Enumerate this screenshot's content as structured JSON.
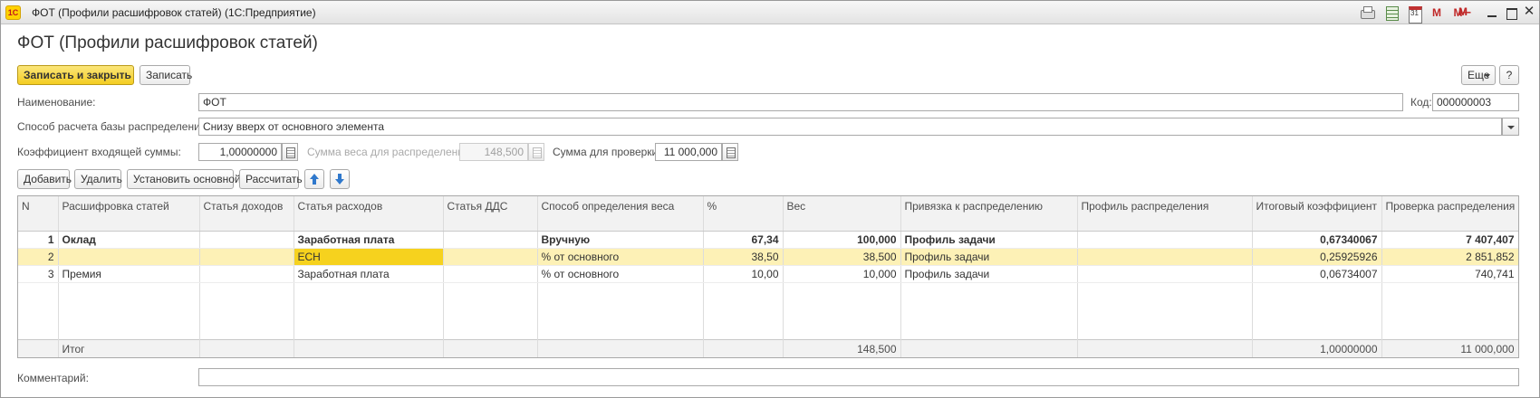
{
  "window": {
    "logo_text": "1С",
    "title": "ФОТ (Профили расшифровок статей)  (1С:Предприятие)",
    "memory_buttons": [
      "M",
      "M+",
      "M-"
    ],
    "close_glyph": "✕"
  },
  "form": {
    "title": "ФОТ (Профили расшифровок статей)",
    "save_close_label": "Записать и закрыть",
    "save_label": "Записать",
    "more_label": "Еще",
    "help_label": "?"
  },
  "fields": {
    "name_label": "Наименование:",
    "name_value": "ФОТ",
    "code_label": "Код:",
    "code_value": "000000003",
    "method_label": "Способ расчета базы распределения:",
    "method_value": "Снизу вверх от основного элемента",
    "coef_label": "Коэффициент входящей суммы:",
    "coef_value": "1,00000000",
    "weight_sum_label": "Сумма веса для распределения:",
    "weight_sum_value": "148,500",
    "check_sum_label": "Сумма для проверки:",
    "check_sum_value": "11 000,000",
    "comment_label": "Комментарий:",
    "comment_value": ""
  },
  "grid_toolbar": {
    "add": "Добавить",
    "delete": "Удалить",
    "set_main": "Установить основной",
    "calculate": "Рассчитать"
  },
  "table": {
    "columns": [
      "N",
      "Расшифровка статей",
      "Статья доходов",
      "Статья расходов",
      "Статья ДДС",
      "Способ определения веса",
      "%",
      "Вес",
      "Привязка к распределению",
      "Профиль распределения",
      "Итоговый коэффициент",
      "Проверка распределения"
    ],
    "rows": [
      {
        "n": "1",
        "item": "Оклад",
        "income": "",
        "expense": "Заработная плата",
        "dds": "",
        "method": "Вручную",
        "pct": "67,34",
        "weight": "100,000",
        "binding": "Профиль задачи",
        "profile": "",
        "coef": "0,67340067",
        "check": "7 407,407"
      },
      {
        "n": "2",
        "item": "",
        "income": "",
        "expense": "ЕСН",
        "dds": "",
        "method": "% от основного",
        "pct": "38,50",
        "weight": "38,500",
        "binding": "Профиль задачи",
        "profile": "",
        "coef": "0,25925926",
        "check": "2 851,852"
      },
      {
        "n": "3",
        "item": "Премия",
        "income": "",
        "expense": "Заработная плата",
        "dds": "",
        "method": "% от основного",
        "pct": "10,00",
        "weight": "10,000",
        "binding": "Профиль задачи",
        "profile": "",
        "coef": "0,06734007",
        "check": "740,741"
      }
    ],
    "totals": {
      "label": "Итог",
      "weight": "148,500",
      "coef": "1,00000000",
      "check": "11 000,000"
    }
  }
}
